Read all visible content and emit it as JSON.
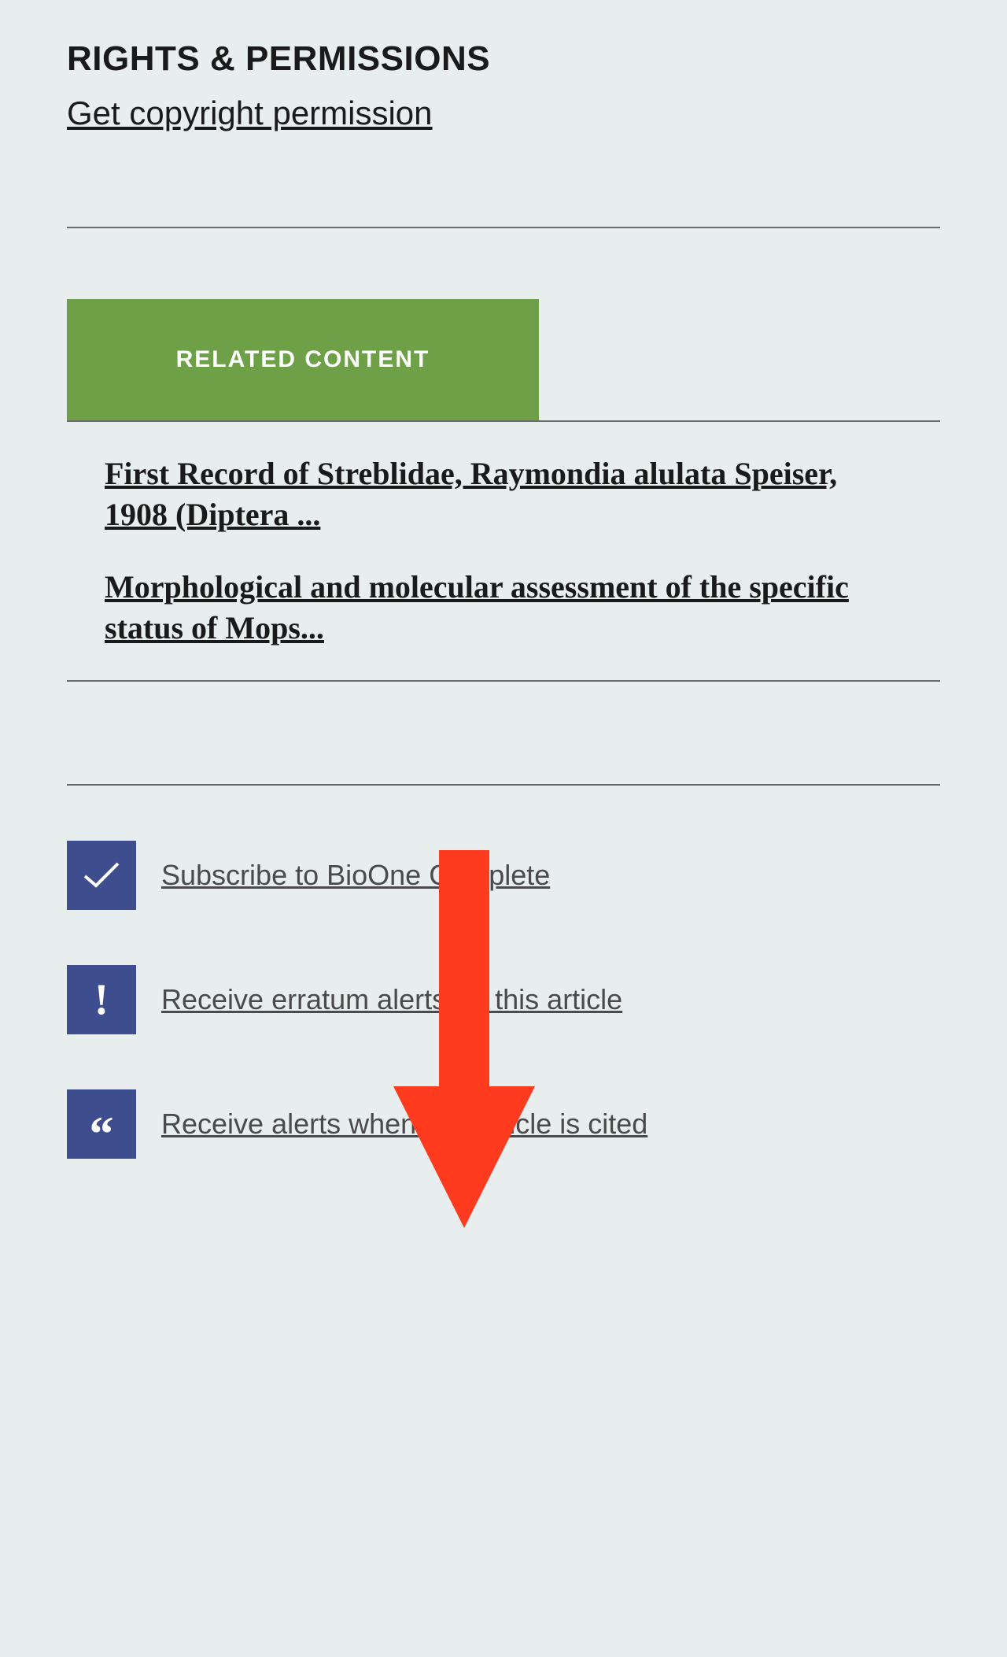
{
  "rights": {
    "title": "RIGHTS & PERMISSIONS",
    "link_text": "Get copyright permission"
  },
  "related": {
    "tab_label": "RELATED CONTENT",
    "items": [
      "First Record of Streblidae, Raymondia alulata Speiser, 1908 (Diptera ...",
      "Morphological and molecular assessment of the specific status of Mops..."
    ]
  },
  "alerts": {
    "subscribe": "Subscribe to BioOne Complete",
    "erratum": "Receive erratum alerts for this article",
    "cited": "Receive alerts when this article is cited"
  },
  "colors": {
    "green": "#6ea047",
    "blue_icon": "#3d4d8e",
    "arrow_red": "#ff3b1f",
    "background": "#e8edee"
  }
}
